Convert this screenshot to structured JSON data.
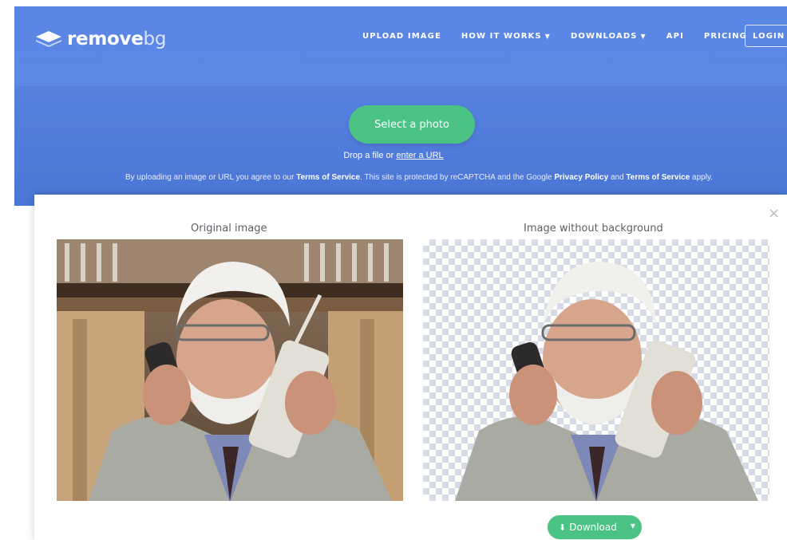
{
  "header": {
    "logo_word": "remove",
    "logo_suffix": "bg",
    "nav": [
      {
        "label": "UPLOAD IMAGE"
      },
      {
        "label": "HOW IT WORKS"
      },
      {
        "label": "DOWNLOADS"
      },
      {
        "label": "API"
      },
      {
        "label": "PRICING"
      }
    ],
    "login_label": "LOGIN"
  },
  "upload": {
    "button_label": "Select a photo",
    "drop_prefix": "Drop a file or ",
    "drop_link": "enter a URL",
    "terms": {
      "t1": "By uploading an image or URL you agree to our ",
      "link1": "Terms of Service",
      "t2": ". This site is protected by reCAPTCHA and the Google ",
      "link2": "Privacy Policy",
      "t3": " and ",
      "link3": "Terms of Service",
      "t4": " apply."
    }
  },
  "result": {
    "close_glyph": "×",
    "original_title": "Original image",
    "processed_title": "Image without background",
    "download_label": "Download"
  },
  "colors": {
    "brand_blue": "#5a86e6",
    "accent_green": "#4bc384"
  }
}
